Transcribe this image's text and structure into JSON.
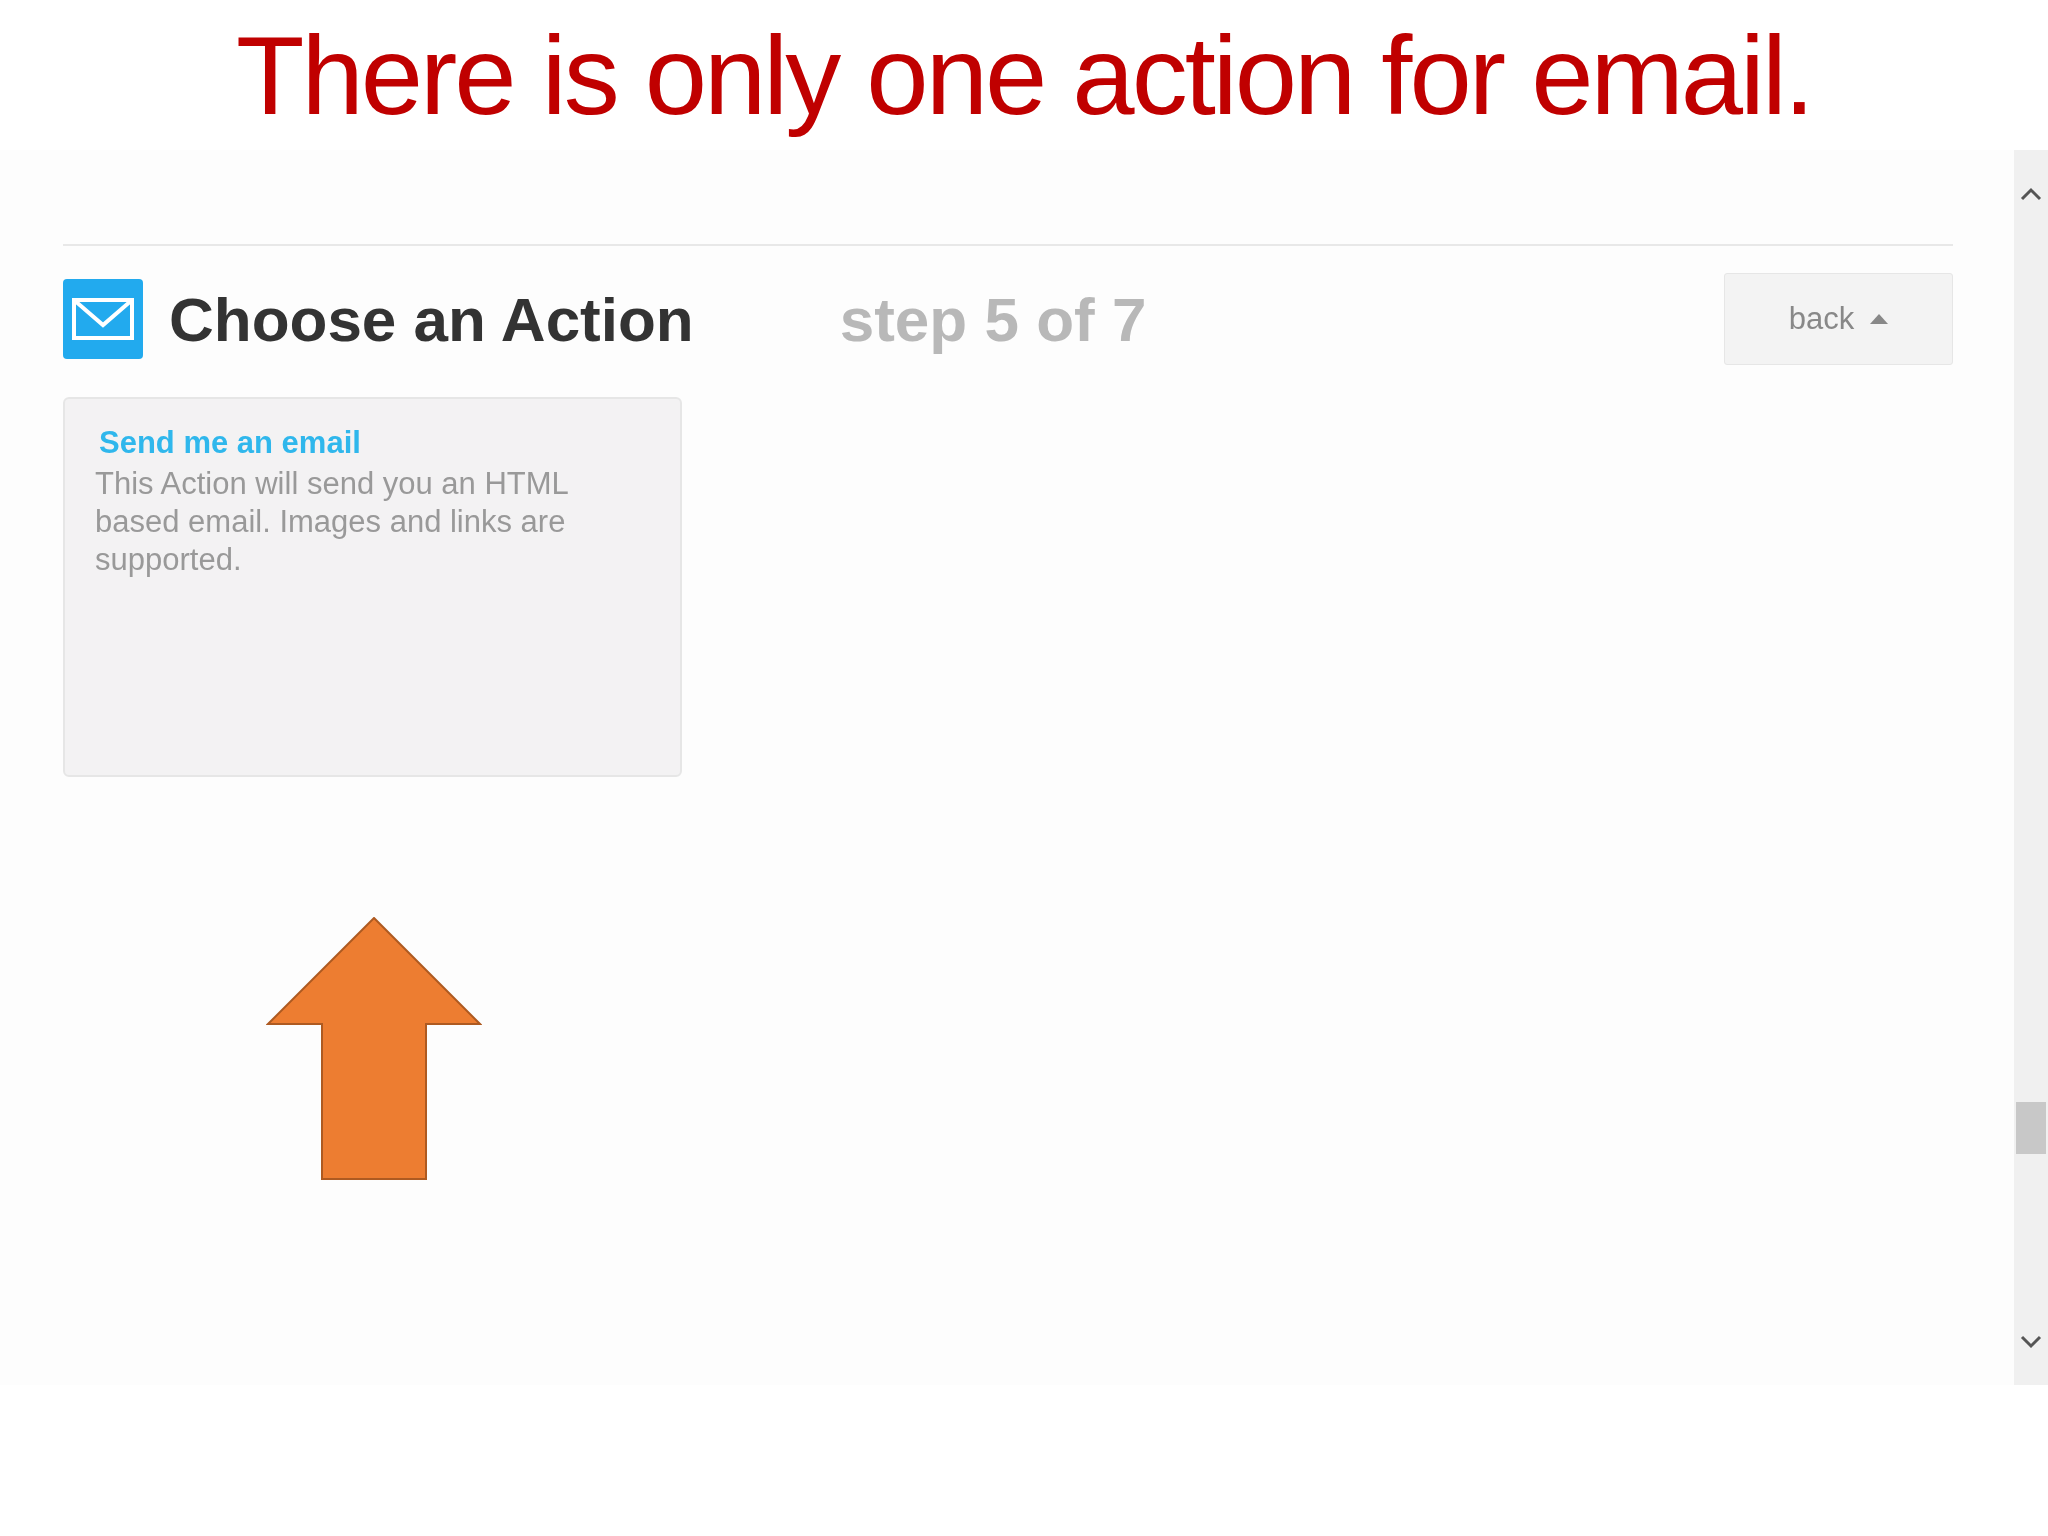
{
  "slide_title": "There is only one action for email.",
  "header": {
    "title": "Choose an Action",
    "step": "step 5 of 7"
  },
  "back_button": {
    "label": "back"
  },
  "actions": [
    {
      "title": "Send me an email",
      "description": "This Action will send you an HTML based email. Images and links are supported."
    }
  ]
}
